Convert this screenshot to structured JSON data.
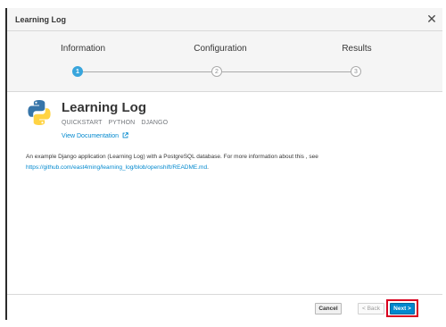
{
  "modal": {
    "title": "Learning Log",
    "close_glyph": "✕"
  },
  "wizard": {
    "steps": [
      {
        "label": "Information",
        "number": "1",
        "state": "active"
      },
      {
        "label": "Configuration",
        "number": "2",
        "state": "inactive"
      },
      {
        "label": "Results",
        "number": "3",
        "state": "inactive"
      }
    ]
  },
  "app": {
    "icon": "python-logo-icon",
    "name": "Learning Log",
    "tags": [
      "QUICKSTART",
      "PYTHON",
      "DJANGO"
    ],
    "doc_link": "View Documentation",
    "doc_link_icon": "external-link-icon",
    "description": "An example Django application (Learning Log) with a PostgreSQL database. For more information about this , see",
    "repo_url": "https://github.com/east4ming/learning_log/blob/openshift/README.md",
    "repo_suffix": "."
  },
  "footer": {
    "cancel_label": "Cancel",
    "back_label": "< Back",
    "next_label": "Next >",
    "highlight_color": "#d9001f"
  },
  "colors": {
    "accent": "#0088ce",
    "active_step": "#39a5dc",
    "python_blue": "#3775a9",
    "python_yellow": "#ffd343"
  }
}
